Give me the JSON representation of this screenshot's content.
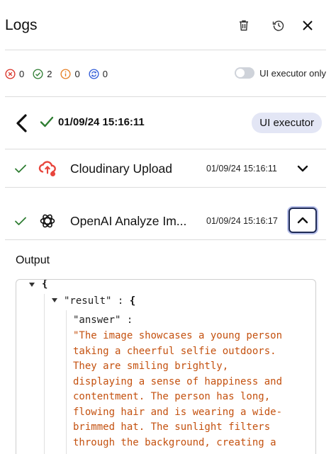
{
  "header": {
    "title": "Logs"
  },
  "counts": [
    {
      "name": "error",
      "value": "0",
      "color": "#d93025"
    },
    {
      "name": "success",
      "value": "2",
      "color": "#2e7d32"
    },
    {
      "name": "info",
      "value": "0",
      "color": "#e67e22"
    },
    {
      "name": "running",
      "value": "0",
      "color": "#2f5bd8"
    }
  ],
  "toggle": {
    "label": "UI executor only",
    "on": false
  },
  "run": {
    "timestamp": "01/09/24 15:16:11",
    "badge": "UI executor"
  },
  "steps": [
    {
      "name": "Cloudinary Upload",
      "time": "01/09/24 15:16:11",
      "icon": "cloudinary-icon",
      "expanded": false
    },
    {
      "name": "OpenAI Analyze Im...",
      "time": "01/09/24 15:16:17",
      "icon": "openai-icon",
      "expanded": true
    }
  ],
  "output": {
    "label": "Output",
    "open_brace": "{",
    "result_key": "\"result\"",
    "colon": ":",
    "result_brace": "{",
    "answer_key": "\"answer\"",
    "answer_colon": ":",
    "answer_lines": [
      "\"The image showcases a young person",
      "taking a cheerful selfie outdoors.",
      "They are smiling brightly,",
      "displaying a sense of happiness and",
      "contentment. The person has long,",
      "flowing hair and is wearing a wide-",
      "brimmed hat. The sunlight filters",
      "through the background, creating a"
    ]
  }
}
